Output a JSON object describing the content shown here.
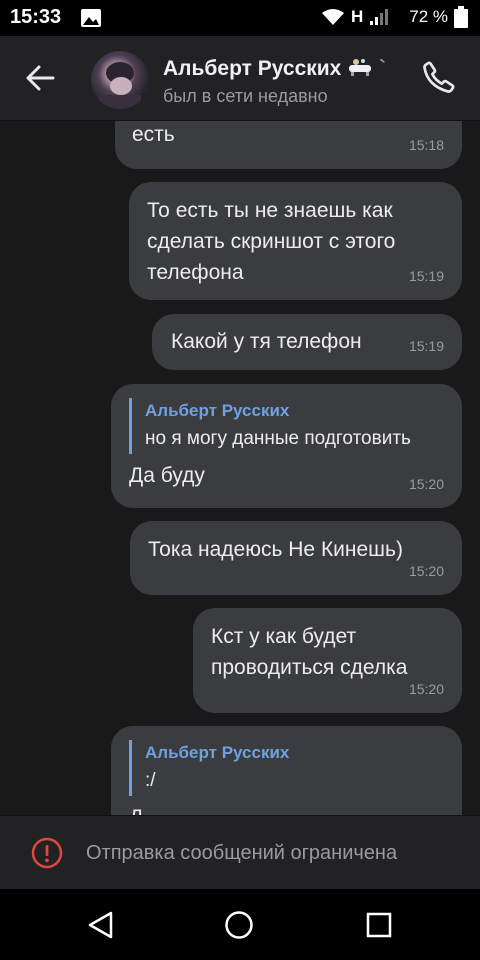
{
  "status_bar": {
    "time": "15:33",
    "network": "H",
    "battery": "72 %"
  },
  "header": {
    "name": "Альберт Русских",
    "status": "был в сети недавно"
  },
  "messages": [
    {
      "text": "есть",
      "time": "15:18"
    },
    {
      "text": "То есть ты не знаешь как\nсделать скриншот с этого\nтелефона",
      "time": "15:19"
    },
    {
      "text": "Какой у тя телефон",
      "time": "15:19"
    },
    {
      "reply_name": "Альберт Русских",
      "reply_text": "но я могу данные подготовить",
      "text": "Да буду",
      "time": "15:20"
    },
    {
      "text": "Тока надеюсь Не Кинешь)",
      "time": "15:20"
    },
    {
      "text": "Кст у как будет\nпроводиться сделка",
      "time": "15:20"
    },
    {
      "reply_name": "Альберт Русских",
      "reply_text": ":/",
      "text": "Д"
    }
  ],
  "footer": {
    "notice": "Отправка сообщений ограничена"
  },
  "colors": {
    "accent": "#6fa1e0",
    "bubble": "#3b3c3f",
    "background": "#19191a",
    "warning": "#e0473a"
  }
}
